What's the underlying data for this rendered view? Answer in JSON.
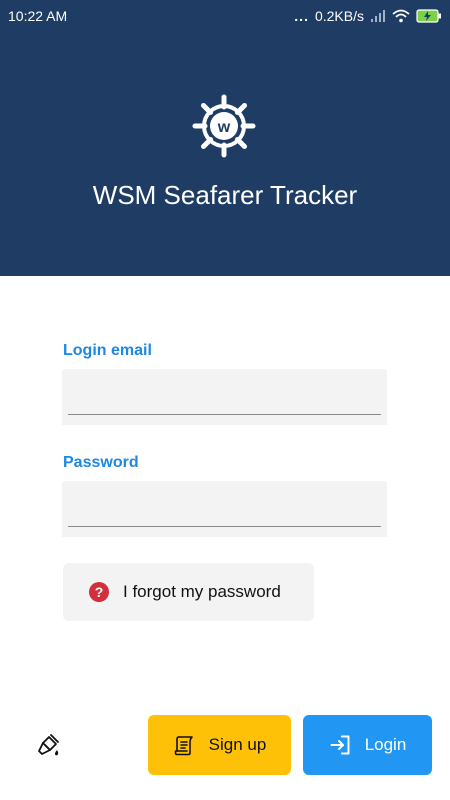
{
  "status_bar": {
    "time": "10:22  AM",
    "dots": "...",
    "net_speed": "0.2KB/s"
  },
  "app": {
    "title": "WSM Seafarer Tracker",
    "logo_letter": "w"
  },
  "form": {
    "email_label": "Login email",
    "email_value": "",
    "password_label": "Password",
    "password_value": ""
  },
  "actions": {
    "forgot_label": "I forgot my password",
    "forgot_icon": "question-circle-icon",
    "signup_label": "Sign up",
    "signup_icon": "scroll-icon",
    "login_label": "Login",
    "login_icon": "login-arrow-icon",
    "theme_icon": "paint-brush-icon"
  },
  "colors": {
    "header_bg": "#1f3d64",
    "accent_blue": "#1e88e5",
    "signup_yellow": "#ffc107",
    "login_blue": "#2196f3",
    "forgot_red": "#d32f3a"
  }
}
